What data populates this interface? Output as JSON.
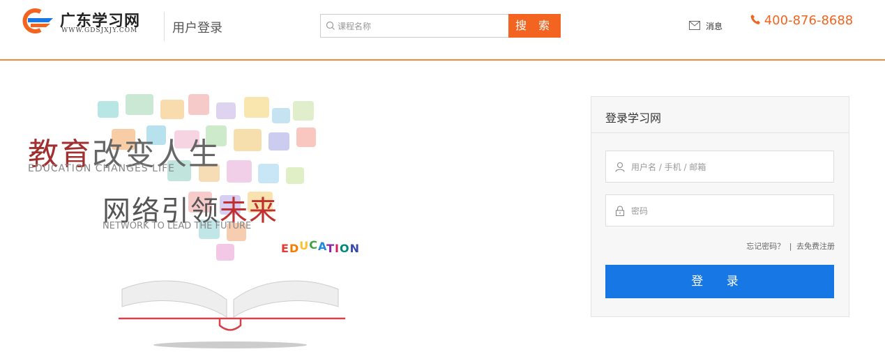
{
  "header": {
    "logo_title": "广东学习网",
    "logo_url_text": "WWW.GDSJXJY.COM",
    "page_title": "用户登录",
    "search_placeholder": "课程名称",
    "search_button": "搜 索",
    "messages_label": "消息",
    "phone": "400-876-8688",
    "accent_color": "#f2641f"
  },
  "hero": {
    "slogan_line1_a": "教育",
    "slogan_line1_b": "改变人生",
    "slogan_line1_en": "EDUCATION CHANGES LIFE",
    "slogan_line2_a": "网络引领",
    "slogan_line2_b": "未来",
    "slogan_line2_en": "NETWORK TO LEAD THE FUTURE",
    "edu_letters": [
      "E",
      "D",
      "U",
      "C",
      "A",
      "T",
      "I",
      "O",
      "N"
    ]
  },
  "login": {
    "title": "登录学习网",
    "username_placeholder": "用户名 / 手机 / 邮箱",
    "password_placeholder": "密码",
    "forgot_link": "忘记密码？",
    "separator": "|",
    "register_link": "去免费注册",
    "submit_label": "登 录",
    "button_color": "#1677e5"
  }
}
